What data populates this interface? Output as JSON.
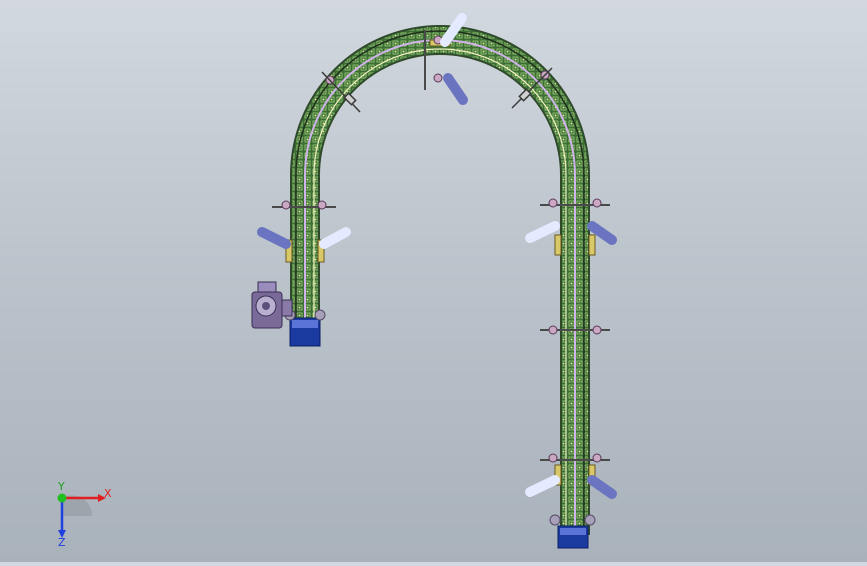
{
  "triad": {
    "x_label": "X",
    "y_label": "Y",
    "z_label": "Z",
    "x_color": "#e02020",
    "y_color": "#20c020",
    "z_color": "#2040e0"
  },
  "colors": {
    "conveyor_chain": "#3c7a3a",
    "conveyor_rail": "#d8b8e8",
    "guide_arms": "#dfe6ff",
    "bracket": "#d0c070",
    "base_blue": "#1a3aa0",
    "motor": "#8a7aa8"
  }
}
